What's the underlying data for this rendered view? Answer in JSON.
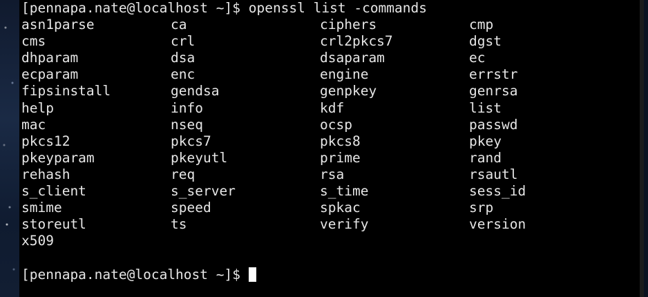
{
  "terminal": {
    "command_prompt": "[pennapa.nate@localhost ~]$ openssl list -commands",
    "final_prompt": "[pennapa.nate@localhost ~]$",
    "rows": [
      [
        "asn1parse",
        "ca",
        "ciphers",
        "cmp"
      ],
      [
        "cms",
        "crl",
        "crl2pkcs7",
        "dgst"
      ],
      [
        "dhparam",
        "dsa",
        "dsaparam",
        "ec"
      ],
      [
        "ecparam",
        "enc",
        "engine",
        "errstr"
      ],
      [
        "fipsinstall",
        "gendsa",
        "genpkey",
        "genrsa"
      ],
      [
        "help",
        "info",
        "kdf",
        "list"
      ],
      [
        "mac",
        "nseq",
        "ocsp",
        "passwd"
      ],
      [
        "pkcs12",
        "pkcs7",
        "pkcs8",
        "pkey"
      ],
      [
        "pkeyparam",
        "pkeyutl",
        "prime",
        "rand"
      ],
      [
        "rehash",
        "req",
        "rsa",
        "rsautl"
      ],
      [
        "s_client",
        "s_server",
        "s_time",
        "sess_id"
      ],
      [
        "smime",
        "speed",
        "spkac",
        "srp"
      ],
      [
        "storeutl",
        "ts",
        "verify",
        "version"
      ],
      [
        "x509",
        "",
        "",
        ""
      ]
    ]
  },
  "colors": {
    "background": "#000000",
    "foreground": "#e6e6e6",
    "cursor": "#ffffff"
  }
}
